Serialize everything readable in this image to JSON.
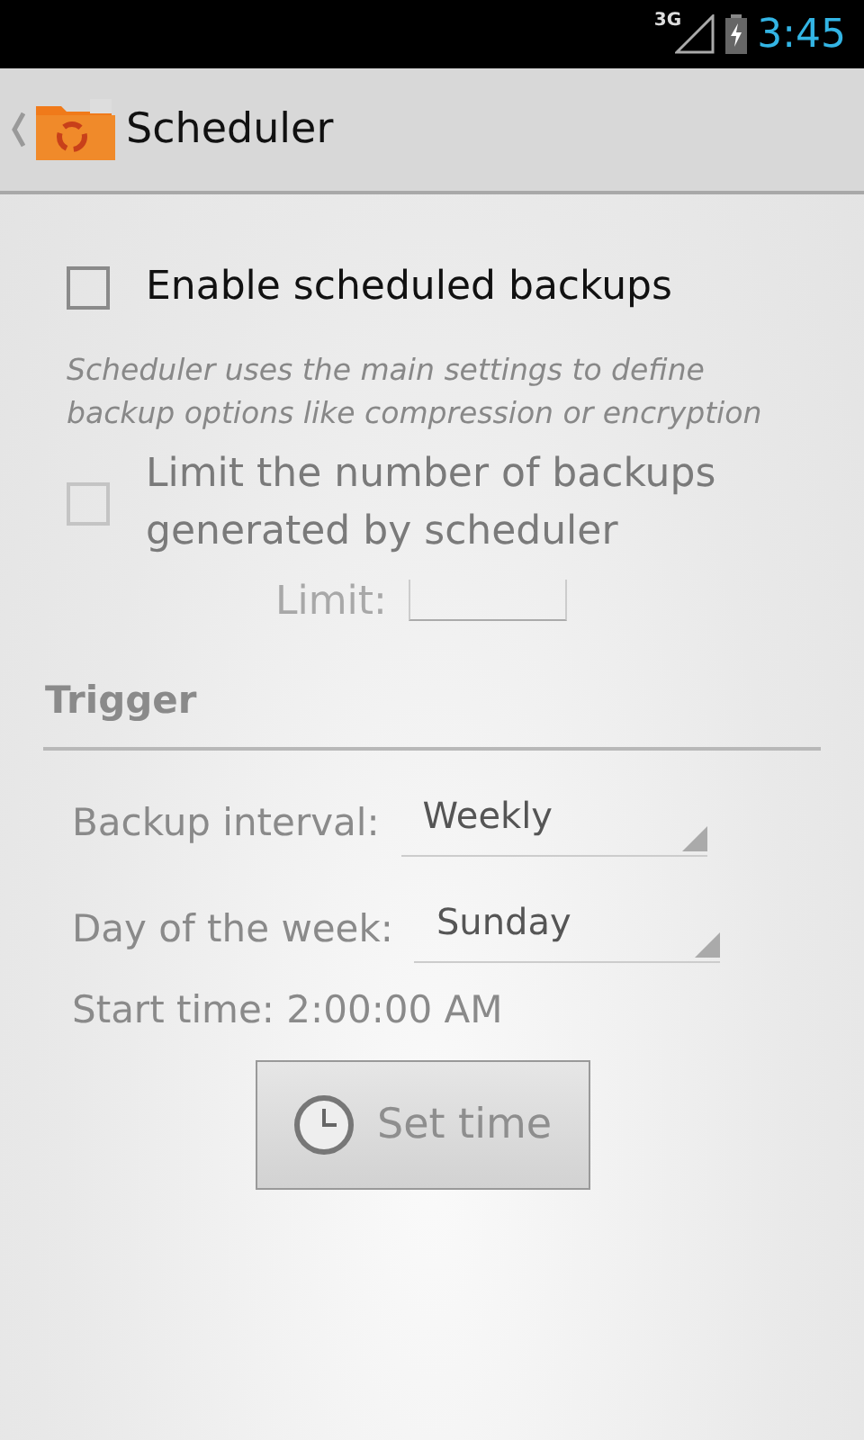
{
  "status_bar": {
    "network": "3G",
    "time": "3:45"
  },
  "action_bar": {
    "title": "Scheduler"
  },
  "enable": {
    "label": "Enable scheduled backups",
    "checked": false,
    "disabled": false
  },
  "description": "Scheduler uses the main settings to define backup options like compression or encryption",
  "limit_backups": {
    "label": "Limit the number of backups generated by scheduler",
    "checked": false,
    "disabled": true
  },
  "limit": {
    "label": "Limit:",
    "disabled": true
  },
  "trigger": {
    "heading": "Trigger",
    "fields": [
      {
        "label": "Backup interval:",
        "value": "Weekly",
        "disabled": true
      },
      {
        "label": "Day of the week:",
        "value": "Sunday",
        "disabled": true
      }
    ],
    "start_time": "Start time: 2:00:00 AM",
    "button": {
      "label": "Set time",
      "disabled": true
    }
  }
}
